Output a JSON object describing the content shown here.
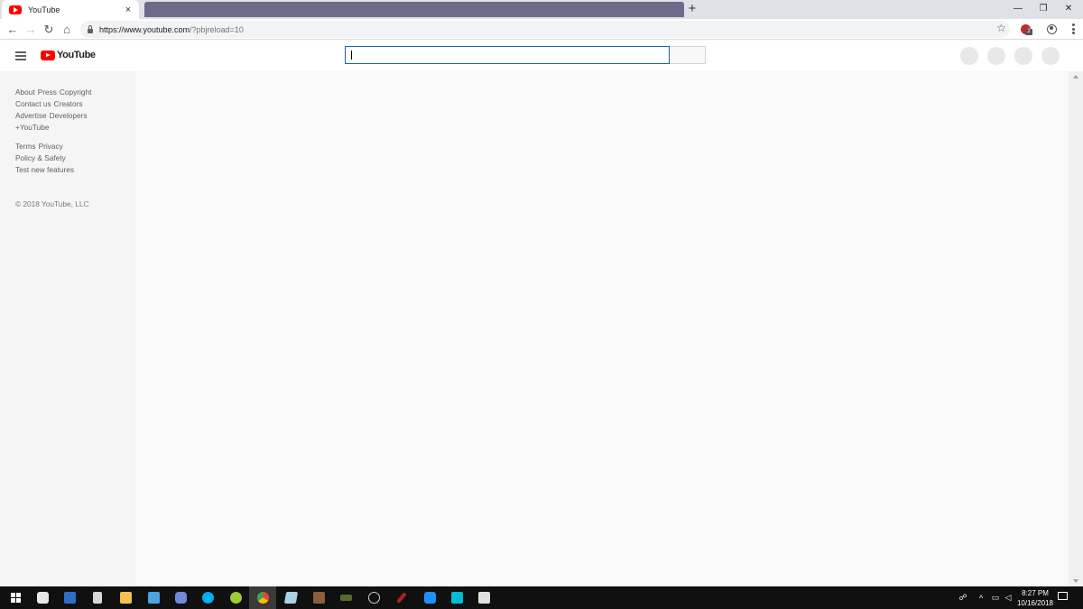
{
  "browser": {
    "tab_title": "YouTube",
    "tab_close": "×",
    "new_tab": "+",
    "url_main": "https://www.youtube.com",
    "url_rest": "/?pbjreload=10",
    "back": "←",
    "forward": "→",
    "reload": "↻",
    "home": "⌂",
    "star": "☆",
    "extension_badge": "2",
    "window_controls": {
      "minimize": "—",
      "restore": "❐",
      "close": "✕"
    }
  },
  "masthead": {
    "logo_text": "YouTube",
    "search_value": "",
    "search_placeholder": ""
  },
  "sidebar": {
    "links_group1": [
      "About",
      "Press",
      "Copyright",
      "Contact us",
      "Creators",
      "Advertise",
      "Developers",
      "+YouTube"
    ],
    "links_group2": [
      "Terms",
      "Privacy",
      "Policy & Safety",
      "Test new features"
    ],
    "copyright": "© 2018 YouTube, LLC"
  },
  "taskbar": {
    "apps": [
      "start",
      "camera",
      "remote-desktop",
      "calculator",
      "file-explorer",
      "mail",
      "discord",
      "skype",
      "tennis-game",
      "chrome",
      "notepad",
      "media-app",
      "game-app",
      "steam",
      "feather-app",
      "blue-app",
      "waves-app",
      "photos"
    ],
    "time": "8:27 PM",
    "date": "10/16/2018"
  },
  "colors": {
    "youtube_red": "#ff0000",
    "search_border": "#1c62b9",
    "tab_inactive": "#6e6b8a",
    "taskbar": "#101010"
  }
}
